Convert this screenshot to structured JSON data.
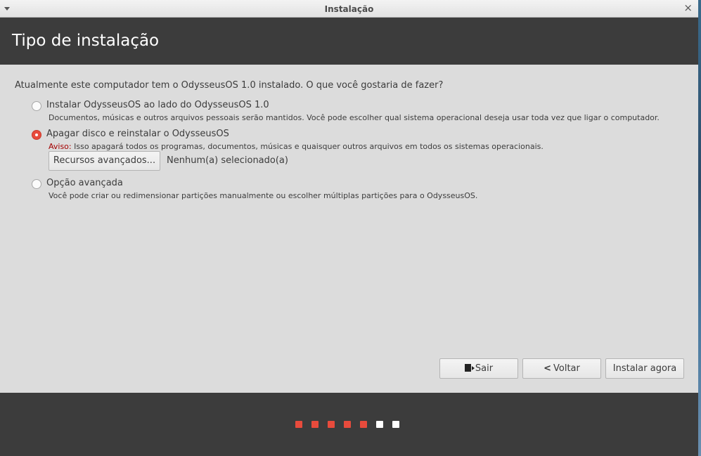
{
  "window": {
    "title": "Instalação",
    "close_glyph": "×"
  },
  "header": {
    "title": "Tipo de instalação"
  },
  "content": {
    "question": "Atualmente este computador tem o OdysseusOS 1.0 instalado. O que você gostaria de fazer?",
    "options": [
      {
        "label": "Instalar OdysseusOS ao lado do OdysseusOS 1.0",
        "description": "Documentos, músicas e outros arquivos pessoais serão mantidos. Você pode escolher qual sistema operacional deseja usar toda vez que ligar o computador.",
        "selected": false
      },
      {
        "label": "Apagar disco e reinstalar o OdysseusOS",
        "warning_label": "Aviso:",
        "description": " Isso apagará todos os programas, documentos, músicas e quaisquer outros arquivos em todos os sistemas operacionais.",
        "selected": true
      },
      {
        "label": "Opção avançada",
        "description": "Você pode criar ou redimensionar partições manualmente ou escolher múltiplas partições para o OdysseusOS.",
        "selected": false
      }
    ],
    "advanced_button": "Recursos avançados...",
    "advanced_status": "Nenhum(a) selecionado(a)"
  },
  "buttons": {
    "quit": "Sair",
    "back": "Voltar",
    "back_glyph": "<",
    "install": "Instalar agora"
  },
  "progress": {
    "completed_steps": 5,
    "total_steps": 7,
    "completed_color": "#e84b3c",
    "pending_color": "#ffffff"
  },
  "colors": {
    "accent": "#e84b3c",
    "header_bg": "#3c3c3c",
    "content_bg": "#dcdcdc",
    "warning": "#a40000"
  }
}
